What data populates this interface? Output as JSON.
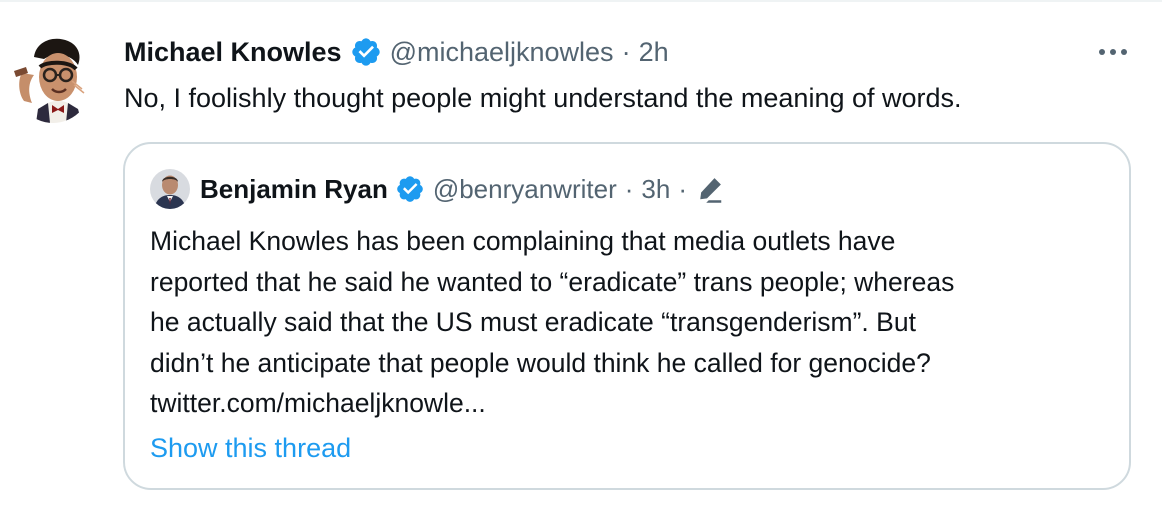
{
  "tweet": {
    "author": {
      "display_name": "Michael Knowles",
      "handle": "@michaeljknowles",
      "separator": "·",
      "time": "2h",
      "verified_color": "#1d9bf0"
    },
    "text": "No, I foolishly thought people might understand the meaning of words.",
    "more_icon": "more-horizontal-icon"
  },
  "quote": {
    "author": {
      "display_name": "Benjamin Ryan",
      "handle": "@benryanwriter",
      "separator": "·",
      "time": "3h",
      "separator2": "·",
      "edited_icon": "pencil-icon"
    },
    "text_lines": [
      "Michael Knowles has been complaining  that media outlets have",
      "reported that he said he wanted to “eradicate” trans people; whereas",
      "he actually said that the US must eradicate “transgenderism”. But",
      "didn’t he anticipate that people would think he called for genocide?",
      "twitter.com/michaeljknowle..."
    ],
    "show_thread": "Show this thread"
  },
  "colors": {
    "text_primary": "#0f1419",
    "text_secondary": "#536471",
    "accent": "#1d9bf0",
    "border": "#cfd9de"
  }
}
